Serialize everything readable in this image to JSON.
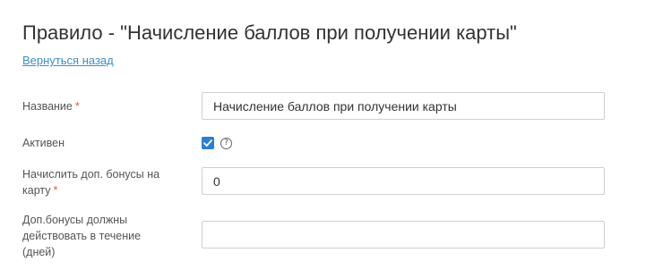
{
  "page": {
    "title": "Правило - \"Начисление баллов при получении карты\"",
    "back_link": "Вернуться назад"
  },
  "form": {
    "name": {
      "label": "Название",
      "required_mark": "*",
      "value": "Начисление баллов при получении карты"
    },
    "active": {
      "label": "Активен",
      "checked": true,
      "help_icon": "question-circle-icon",
      "help_glyph": "?"
    },
    "bonus": {
      "label_line1": "Начислить доп. бонусы на",
      "label_line2": "карту",
      "required_mark": "*",
      "value": "0"
    },
    "duration": {
      "label_line1": "Доп.бонусы должны",
      "label_line2": "действовать в течение",
      "label_line3": "(дней)",
      "value": ""
    }
  },
  "colors": {
    "link": "#3d8fc6",
    "required": "#e05a4a",
    "checkbox": "#2a7fd4"
  }
}
